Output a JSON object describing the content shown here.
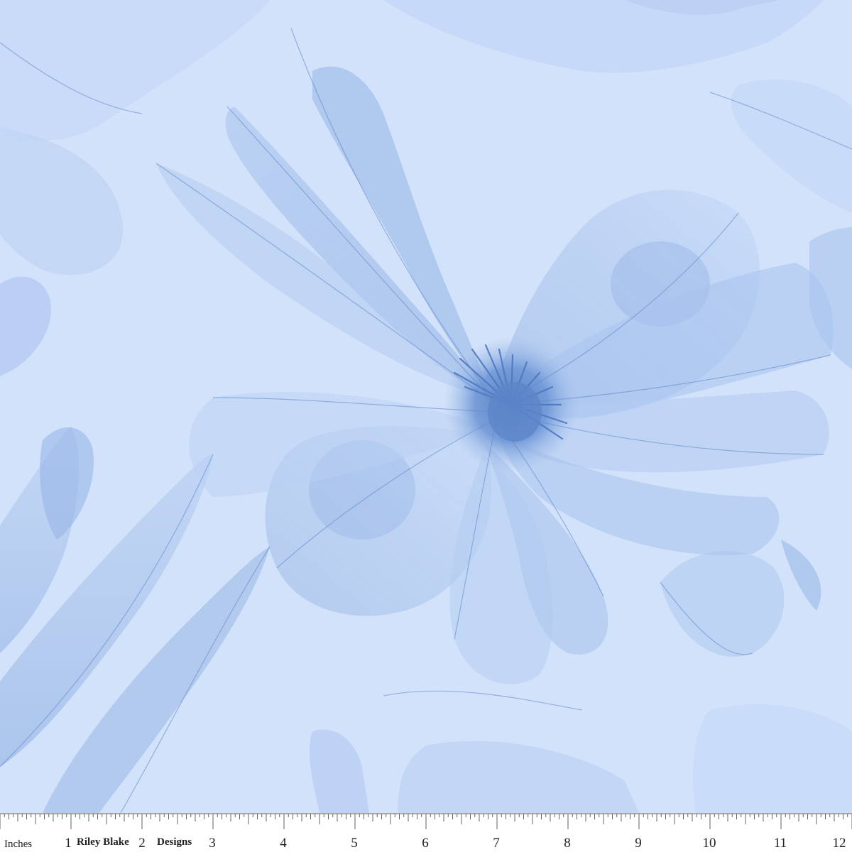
{
  "image": {
    "subject": "sheer blue x-ray style flower fabric print",
    "colors": {
      "background": "#d2e2fa",
      "petal_light": "#bcd2f3",
      "petal_mid": "#9dbbe8",
      "petal_deep": "#6f97d6",
      "vein": "#5d86c9",
      "center": "#4d78bf"
    }
  },
  "ruler": {
    "unit_label": "Inches",
    "brand_words": [
      "Riley Blake",
      "Designs"
    ],
    "numbers": [
      "1",
      "2",
      "3",
      "4",
      "5",
      "6",
      "7",
      "8",
      "9",
      "10",
      "11",
      "12"
    ]
  }
}
